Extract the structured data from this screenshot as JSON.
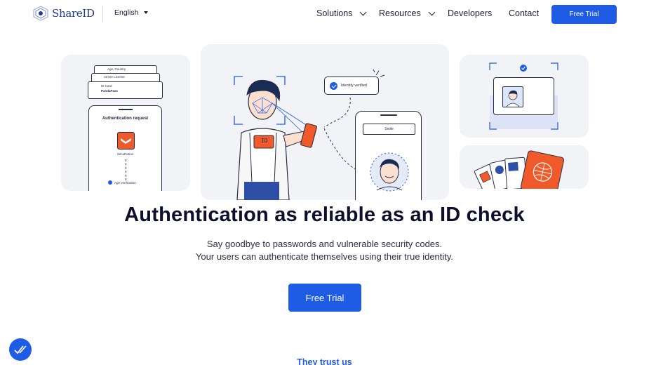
{
  "nav": {
    "logo_text": "ShareID",
    "language": "English",
    "links": [
      {
        "label": "Solutions"
      },
      {
        "label": "Resources"
      },
      {
        "label": "Developers"
      },
      {
        "label": "Contact"
      }
    ],
    "cta": "Free Trial"
  },
  "hero_art": {
    "left_cards": [
      "Age, Country",
      "Driver License",
      "ID Card",
      "PandaPass"
    ],
    "auth_request": "Authentication request",
    "app_name": "SécuRation",
    "age_verification": "Age verification",
    "identity_verified": "Identity verified",
    "smile": "Smile",
    "id_label": "ID"
  },
  "main": {
    "headline": "Authentication as reliable as an ID check",
    "subtitle_line1": "Say goodbye to passwords and vulnerable security codes.",
    "subtitle_line2": "Your users can authenticate themselves using their true identity.",
    "cta": "Free Trial",
    "trust_heading": "They trust us"
  },
  "colors": {
    "brand_blue": "#1f5ce6",
    "panel_bg": "#f2f3f7",
    "ink": "#0d0f2c",
    "accent_orange": "#f05a2a"
  }
}
